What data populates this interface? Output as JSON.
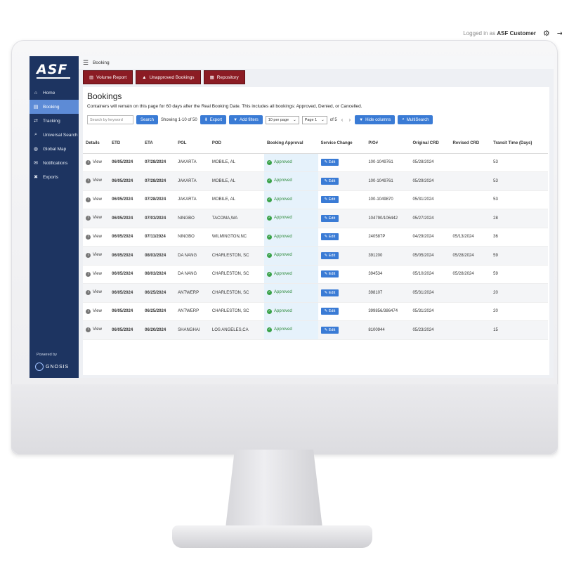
{
  "header": {
    "logged_in_prefix": "Logged in as",
    "user": "ASF Customer"
  },
  "sidebar": {
    "logo": "ASF",
    "items": [
      {
        "label": "Home",
        "icon": "home-icon"
      },
      {
        "label": "Booking",
        "icon": "document-icon",
        "active": true
      },
      {
        "label": "Tracking",
        "icon": "shuffle-icon"
      },
      {
        "label": "Universal Search",
        "icon": "search-icon"
      },
      {
        "label": "Global Map",
        "icon": "globe-icon"
      },
      {
        "label": "Notifications",
        "icon": "mail-icon"
      },
      {
        "label": "Exports",
        "icon": "exports-icon"
      }
    ],
    "powered_by": "Powered by",
    "brand": "GNOSIS"
  },
  "breadcrumb": "Booking",
  "tabs": [
    "Volume Report",
    "Unapproved Bookings",
    "Repository"
  ],
  "page": {
    "title": "Bookings",
    "description": "Containers will remain on this page for 60 days after the Real Booking Date. This includes all bookings: Approved, Denied, or Cancelled."
  },
  "controls": {
    "search_placeholder": "Search by keyword",
    "search_button": "Search",
    "showing": "Showing 1-10 of 50",
    "export": "Export",
    "add_filters": "Add filters",
    "per_page": "10 per page",
    "page": "Page 1",
    "of": "of 5",
    "hide_columns": "Hide columns",
    "multisearch": "MultiSearch"
  },
  "table": {
    "columns": [
      "Details",
      "ETD",
      "ETA",
      "POL",
      "POD",
      "Booking Approval",
      "Service Change",
      "P/O#",
      "Original CRD",
      "Revised CRD",
      "Transit Time (Days)"
    ],
    "view_label": "View",
    "approved_label": "Approved",
    "edit_label": "Edit",
    "rows": [
      {
        "etd": "06/05/2024",
        "eta": "07/28/2024",
        "pol": "JAKARTA",
        "pod": "MOBILE, AL",
        "po": "100-1049761",
        "ocrd": "05/28/2024",
        "rcrd": "",
        "tt": "53"
      },
      {
        "etd": "06/05/2024",
        "eta": "07/28/2024",
        "pol": "JAKARTA",
        "pod": "MOBILE, AL",
        "po": "100-1049761",
        "ocrd": "05/29/2024",
        "rcrd": "",
        "tt": "53"
      },
      {
        "etd": "06/05/2024",
        "eta": "07/28/2024",
        "pol": "JAKARTA",
        "pod": "MOBILE, AL",
        "po": "100-1049870",
        "ocrd": "05/31/2024",
        "rcrd": "",
        "tt": "53"
      },
      {
        "etd": "06/05/2024",
        "eta": "07/03/2024",
        "pol": "NINGBO",
        "pod": "TACOMA,WA",
        "po": "104790/106442",
        "ocrd": "05/27/2024",
        "rcrd": "",
        "tt": "28"
      },
      {
        "etd": "06/05/2024",
        "eta": "07/11/2024",
        "pol": "NINGBO",
        "pod": "WILMINGTON,NC",
        "po": "240587P",
        "ocrd": "04/29/2024",
        "rcrd": "05/13/2024",
        "tt": "36"
      },
      {
        "etd": "06/05/2024",
        "eta": "08/03/2024",
        "pol": "DA NANG",
        "pod": "CHARLESTON, SC",
        "po": "391200",
        "ocrd": "05/05/2024",
        "rcrd": "05/28/2024",
        "tt": "59"
      },
      {
        "etd": "06/05/2024",
        "eta": "08/03/2024",
        "pol": "DA NANG",
        "pod": "CHARLESTON, SC",
        "po": "394534",
        "ocrd": "05/10/2024",
        "rcrd": "05/28/2024",
        "tt": "59"
      },
      {
        "etd": "06/05/2024",
        "eta": "06/25/2024",
        "pol": "ANTWERP",
        "pod": "CHARLESTON, SC",
        "po": "398107",
        "ocrd": "05/31/2024",
        "rcrd": "",
        "tt": "20"
      },
      {
        "etd": "06/05/2024",
        "eta": "06/25/2024",
        "pol": "ANTWERP",
        "pod": "CHARLESTON, SC",
        "po": "399856/386474",
        "ocrd": "05/31/2024",
        "rcrd": "",
        "tt": "20"
      },
      {
        "etd": "06/05/2024",
        "eta": "06/20/2024",
        "pol": "SHANGHAI",
        "pod": "LOS ANGELES,CA",
        "po": "8100944",
        "ocrd": "05/23/2024",
        "rcrd": "",
        "tt": "15"
      }
    ]
  }
}
